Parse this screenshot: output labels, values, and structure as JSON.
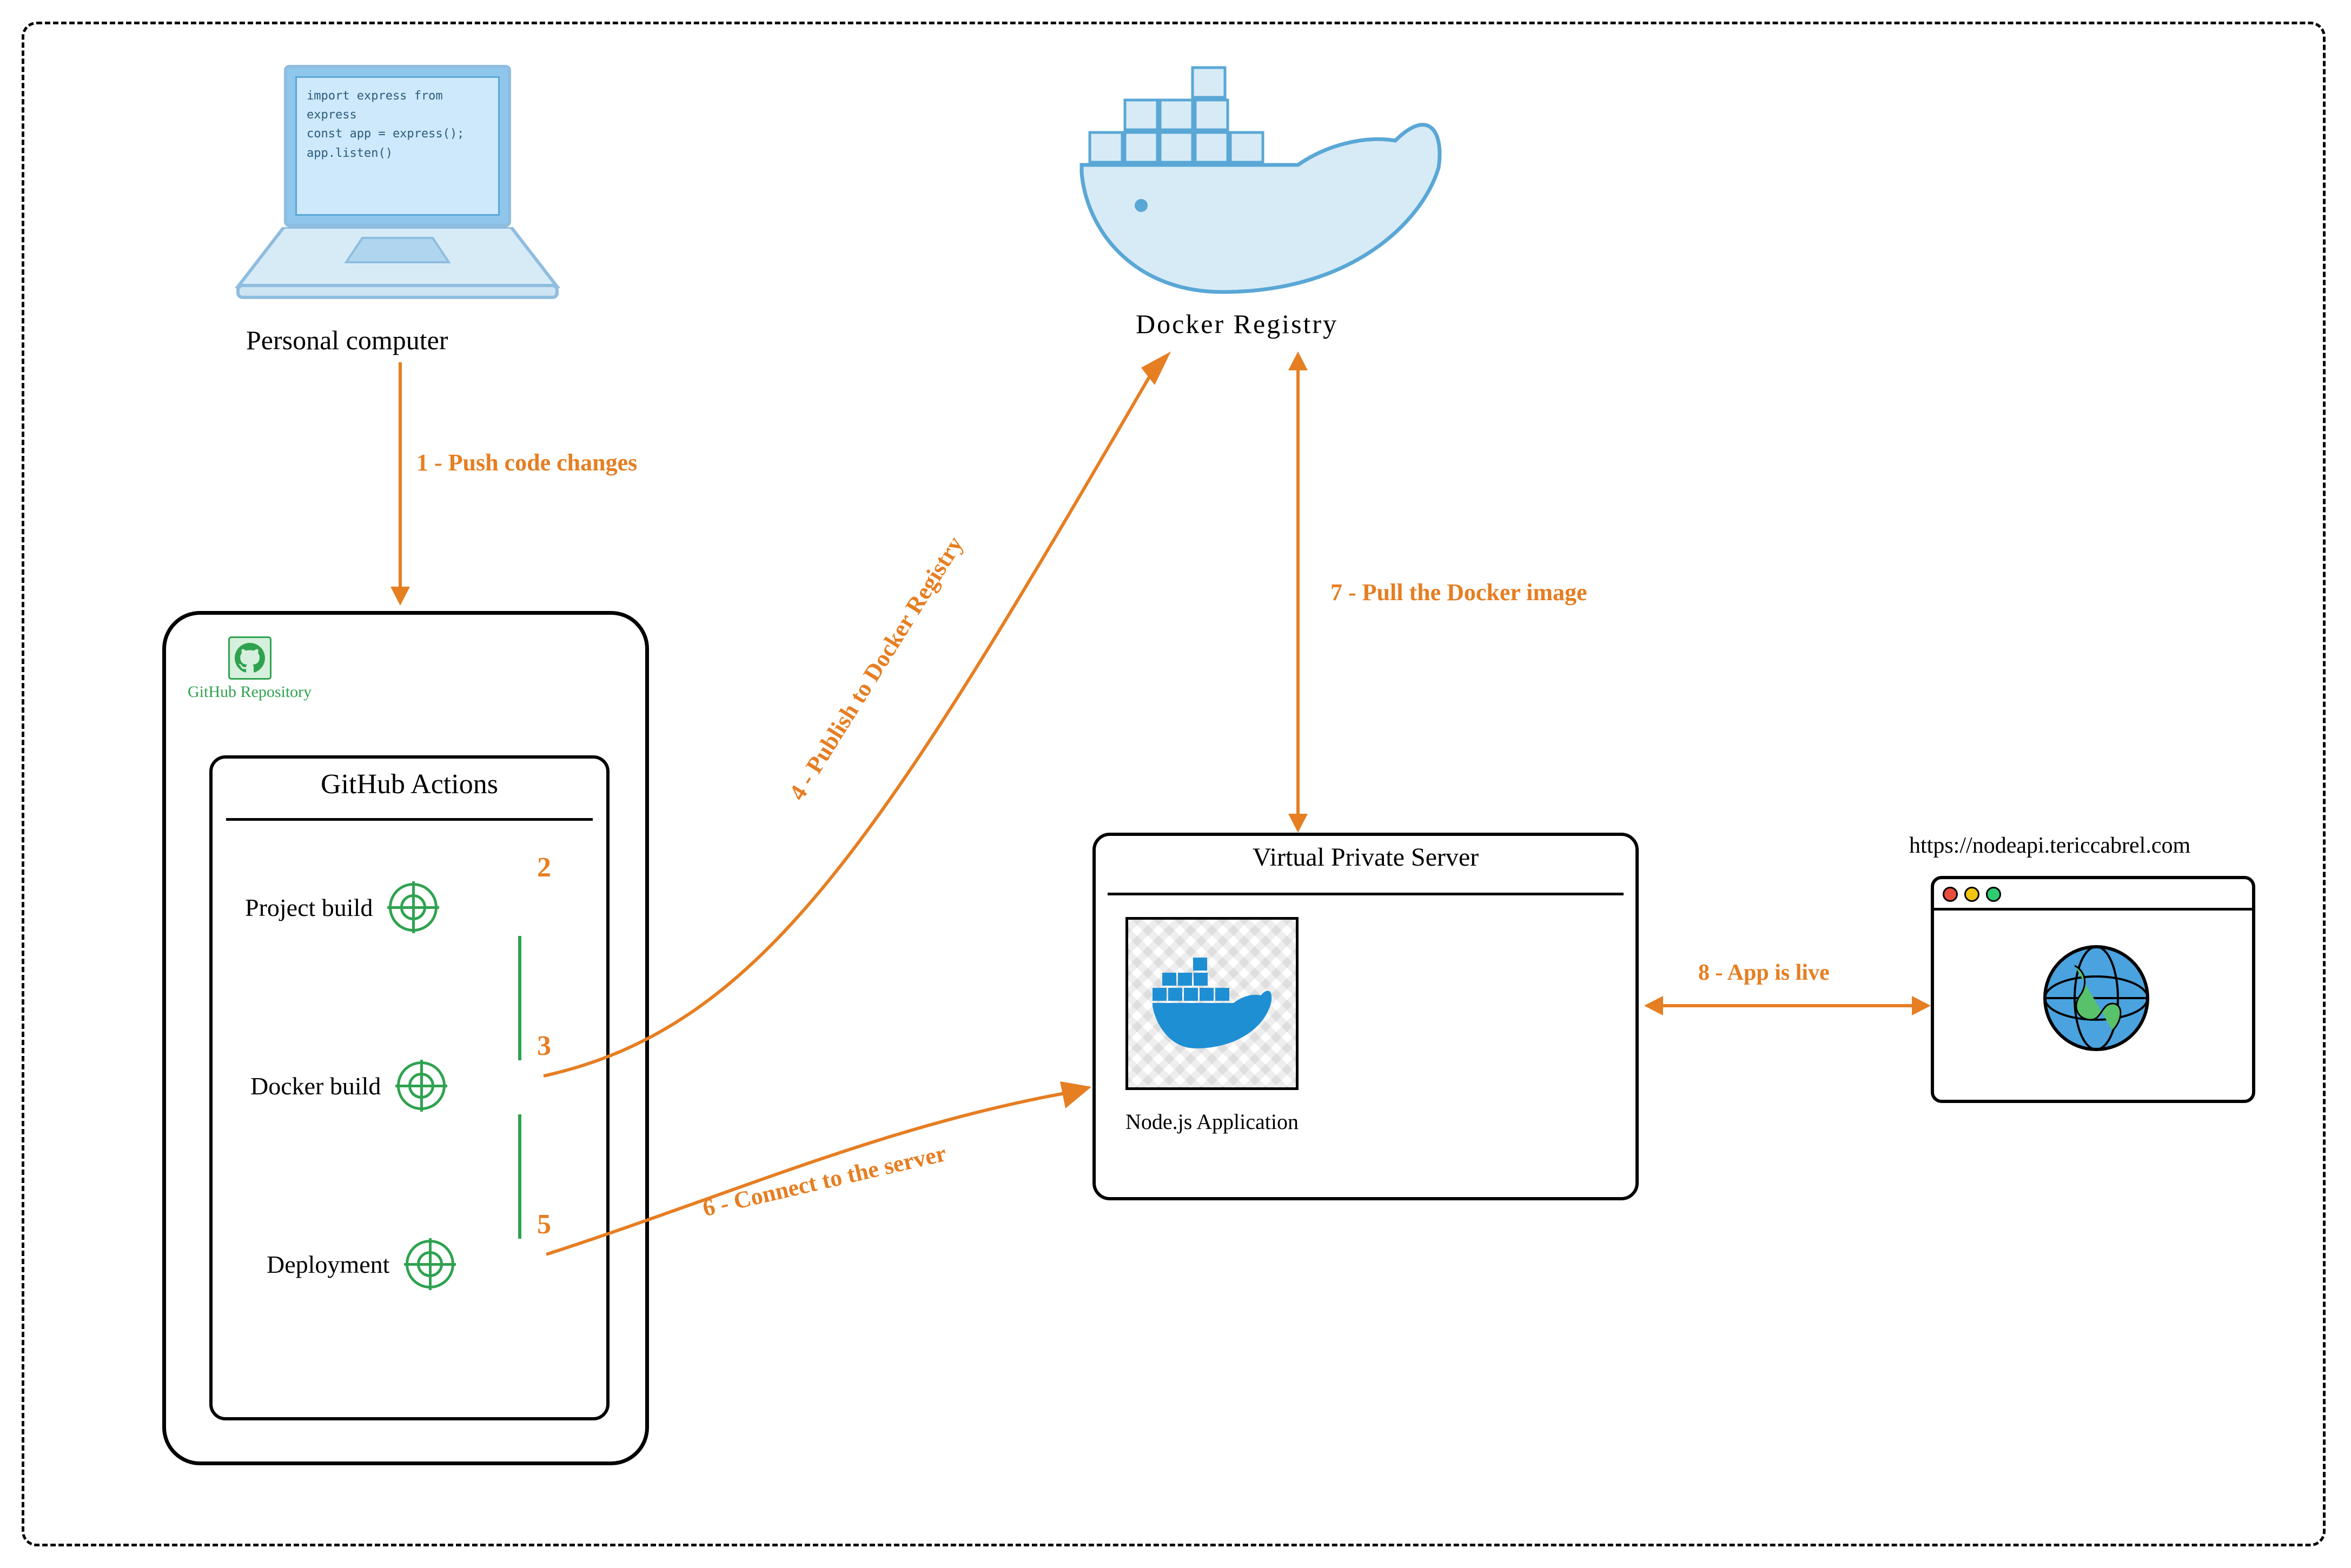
{
  "laptop": {
    "code_line1": "import express from express",
    "code_line2": "const app = express();",
    "code_line3": "app.listen()",
    "caption": "Personal computer"
  },
  "github": {
    "repo_label": "GitHub Repository",
    "actions_title": "GitHub Actions",
    "steps": {
      "build": {
        "label": "Project build",
        "num": "2"
      },
      "docker": {
        "label": "Docker build",
        "num": "3"
      },
      "deploy": {
        "label": "Deployment",
        "num": "5"
      }
    }
  },
  "docker": {
    "caption": "Docker  Registry"
  },
  "vps": {
    "title": "Virtual Private Server",
    "app_label": "Node.js Application"
  },
  "browser": {
    "url": "https://nodeapi.tericcabrel.com"
  },
  "arrows": {
    "a1": "1 - Push code changes",
    "a4": "4 - Publish to Docker Registry",
    "a6": "6 - Connect to the server",
    "a7": "7 - Pull the Docker image",
    "a8": "8 - App is live"
  }
}
